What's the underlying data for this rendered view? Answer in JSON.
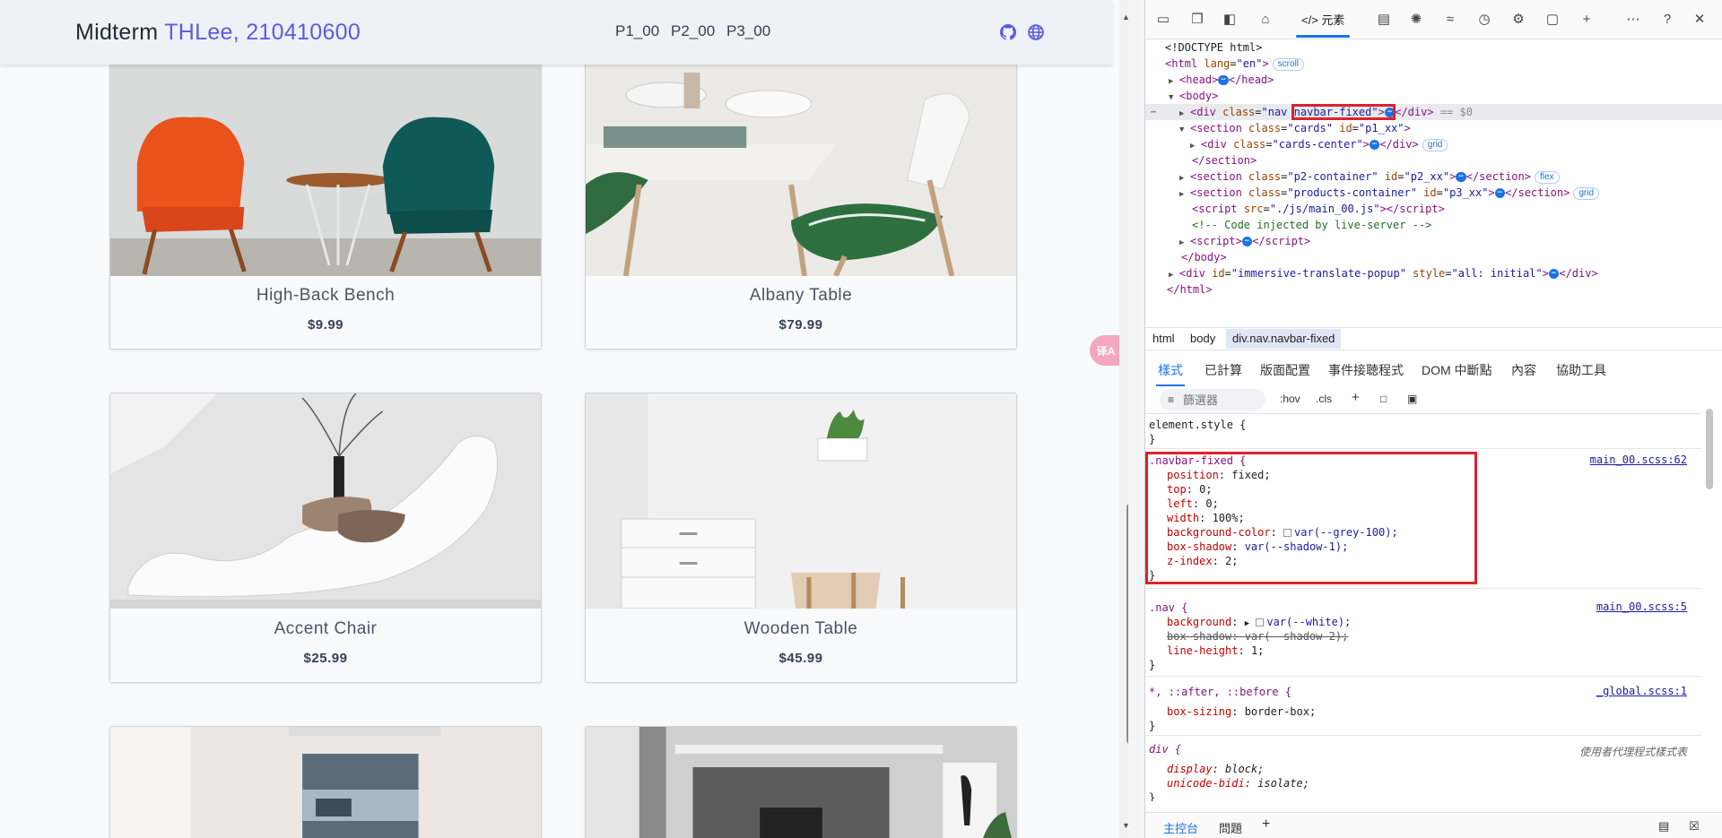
{
  "page": {
    "navbar": {
      "title_plain": "Midterm ",
      "title_accent": "THLee, 210410600",
      "links": [
        "P1_00",
        "P2_00",
        "P3_00"
      ],
      "icons": [
        "github-icon",
        "globe-icon"
      ]
    },
    "products": [
      {
        "name": "High-Back Bench",
        "price": "$9.99"
      },
      {
        "name": "Albany Table",
        "price": "$79.99"
      },
      {
        "name": "Accent Chair",
        "price": "$25.99"
      },
      {
        "name": "Wooden Table",
        "price": "$45.99"
      }
    ],
    "translate_badge": "译A"
  },
  "devtools": {
    "toolbar": {
      "elements_tab": "</> 元素",
      "icons": [
        "device-icon",
        "inspect-icon",
        "sidebar-icon",
        "home-icon",
        "console-icon",
        "bug-icon",
        "wifi-icon",
        "performance-icon",
        "memory-icon",
        "application-icon",
        "add-icon",
        "more-icon",
        "help-icon",
        "close-icon"
      ]
    },
    "dom": {
      "doctype": "<!DOCTYPE html>",
      "html_open": "html",
      "html_lang": "en",
      "scroll_badge": "scroll",
      "head": "head",
      "body": "body",
      "nav_class_a": "nav ",
      "nav_class_b": "navbar-fixed",
      "eq_ref": "== $0",
      "section_cards_class": "cards",
      "section_cards_id": "p1_xx",
      "cards_center_class": "cards-center",
      "grid_badge": "grid",
      "flex_badge": "flex",
      "section_close": "section",
      "section_p2_class": "p2-container",
      "section_p2_id": "p2_xx",
      "section_p3_class": "products-container",
      "section_p3_id": "p3_xx",
      "script_src": "./js/main_00.js",
      "comment": "<!-- Code injected by live-server -->",
      "popup_id": "immersive-translate-popup",
      "popup_style": "all: initial",
      "html_close": "html"
    },
    "breadcrumb": [
      "html",
      "body",
      "div.nav.navbar-fixed"
    ],
    "style_tabs": [
      "樣式",
      "已計算",
      "版面配置",
      "事件接聴程式",
      "DOM 中斷點",
      "內容",
      "協助工具"
    ],
    "filter": {
      "placeholder": "篩選器",
      "hov": ":hov",
      "cls": ".cls"
    },
    "rules": {
      "element_style": "element.style {",
      "navbar_fixed_selector": ".navbar-fixed {",
      "navbar_fixed_source": "main_00.scss:62",
      "navbar_fixed_props": [
        {
          "name": "position",
          "value": "fixed;"
        },
        {
          "name": "top",
          "value": "0;"
        },
        {
          "name": "left",
          "value": "0;"
        },
        {
          "name": "width",
          "value": "100%;"
        },
        {
          "name": "background-color",
          "value": "var(--grey-100);"
        },
        {
          "name": "box-shadow",
          "value": "var(--shadow-1);"
        },
        {
          "name": "z-index",
          "value": "2;"
        }
      ],
      "nav_selector": ".nav {",
      "nav_source": "main_00.scss:5",
      "nav_props": [
        {
          "name": "background",
          "value": "var(--white);"
        },
        {
          "name": "box-shadow",
          "value": "var(--shadow-2);"
        },
        {
          "name": "line-height",
          "value": "1;"
        }
      ],
      "global_selector": "*, ::after, ::before {",
      "global_source": "_global.scss:1",
      "global_props": [
        {
          "name": "box-sizing",
          "value": "border-box;"
        }
      ],
      "div_selector": "div {",
      "div_source": "使用者代理程式樣式表",
      "div_props": [
        {
          "name": "display",
          "value": "block;"
        },
        {
          "name": "unicode-bidi",
          "value": "isolate;"
        }
      ],
      "close_brace": "}"
    },
    "drawer": {
      "tabs": [
        "主控台",
        "問題"
      ]
    }
  },
  "colors": {
    "accent": "#5b5ce0",
    "highlight": "#e0202a",
    "devtools_blue": "#1a73e8"
  }
}
